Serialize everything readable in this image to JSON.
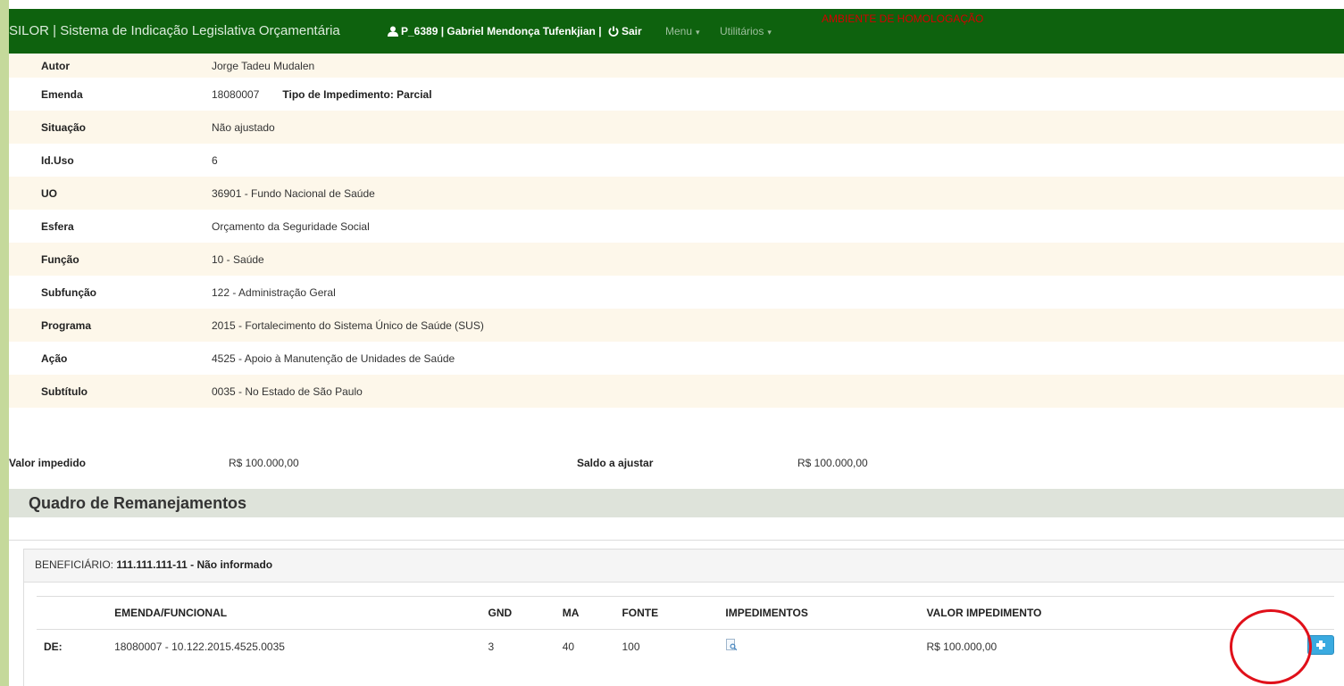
{
  "navbar": {
    "brand": "SILOR | Sistema de Indicação Legislativa Orçamentária",
    "user": "P_6389 | Gabriel Mendonça Tufenkjian |",
    "logout": "Sair",
    "menu": "Menu",
    "utilities": "Utilitários",
    "environment": "AMBIENTE DE HOMOLOGAÇÃO",
    "bg_color": "#0e620e"
  },
  "details": {
    "autor": {
      "label": "Autor",
      "value": "Jorge Tadeu Mudalen"
    },
    "emenda": {
      "label": "Emenda",
      "value": "18080007",
      "impediment_label": "Tipo de Impedimento: Parcial"
    },
    "situacao": {
      "label": "Situação",
      "value": "Não ajustado"
    },
    "iduso": {
      "label": "Id.Uso",
      "value": "6"
    },
    "uo": {
      "label": "UO",
      "value": "36901 - Fundo Nacional de Saúde"
    },
    "esfera": {
      "label": "Esfera",
      "value": "Orçamento da Seguridade Social"
    },
    "funcao": {
      "label": "Função",
      "value": "10 - Saúde"
    },
    "subfuncao": {
      "label": "Subfunção",
      "value": "122 - Administração Geral"
    },
    "programa": {
      "label": "Programa",
      "value": "2015 - Fortalecimento do Sistema Único de Saúde (SUS)"
    },
    "acao": {
      "label": "Ação",
      "value": "4525 - Apoio à Manutenção de Unidades de Saúde"
    },
    "subtitulo": {
      "label": "Subtítulo",
      "value": "0035 - No Estado de São Paulo"
    }
  },
  "values": {
    "impedido_label": "Valor impedido",
    "impedido_value": "R$ 100.000,00",
    "saldo_label": "Saldo a ajustar",
    "saldo_value": "R$ 100.000,00"
  },
  "section": {
    "title": "Quadro de Remanejamentos"
  },
  "panel": {
    "beneficiary_prefix": "BENEFICIÁRIO:",
    "beneficiary": "111.111.111-11 - Não informado"
  },
  "remanejamentos": {
    "headers": [
      "",
      "EMENDA/FUNCIONAL",
      "GND",
      "MA",
      "FONTE",
      "IMPEDIMENTOS",
      "VALOR IMPEDIMENTO",
      ""
    ],
    "row": {
      "de": "DE:",
      "emenda": "18080007 - 10.122.2015.4525.0035",
      "gnd": "3",
      "ma": "40",
      "fonte": "100",
      "valor": "R$ 100.000,00"
    }
  },
  "icons": {
    "user": "user-icon",
    "power": "power-icon",
    "document": "document-search-icon",
    "add": "plus-icon"
  },
  "colors": {
    "accent_button": "#3aaae0",
    "highlight": "#e0101a",
    "environment_text": "#d40000"
  }
}
